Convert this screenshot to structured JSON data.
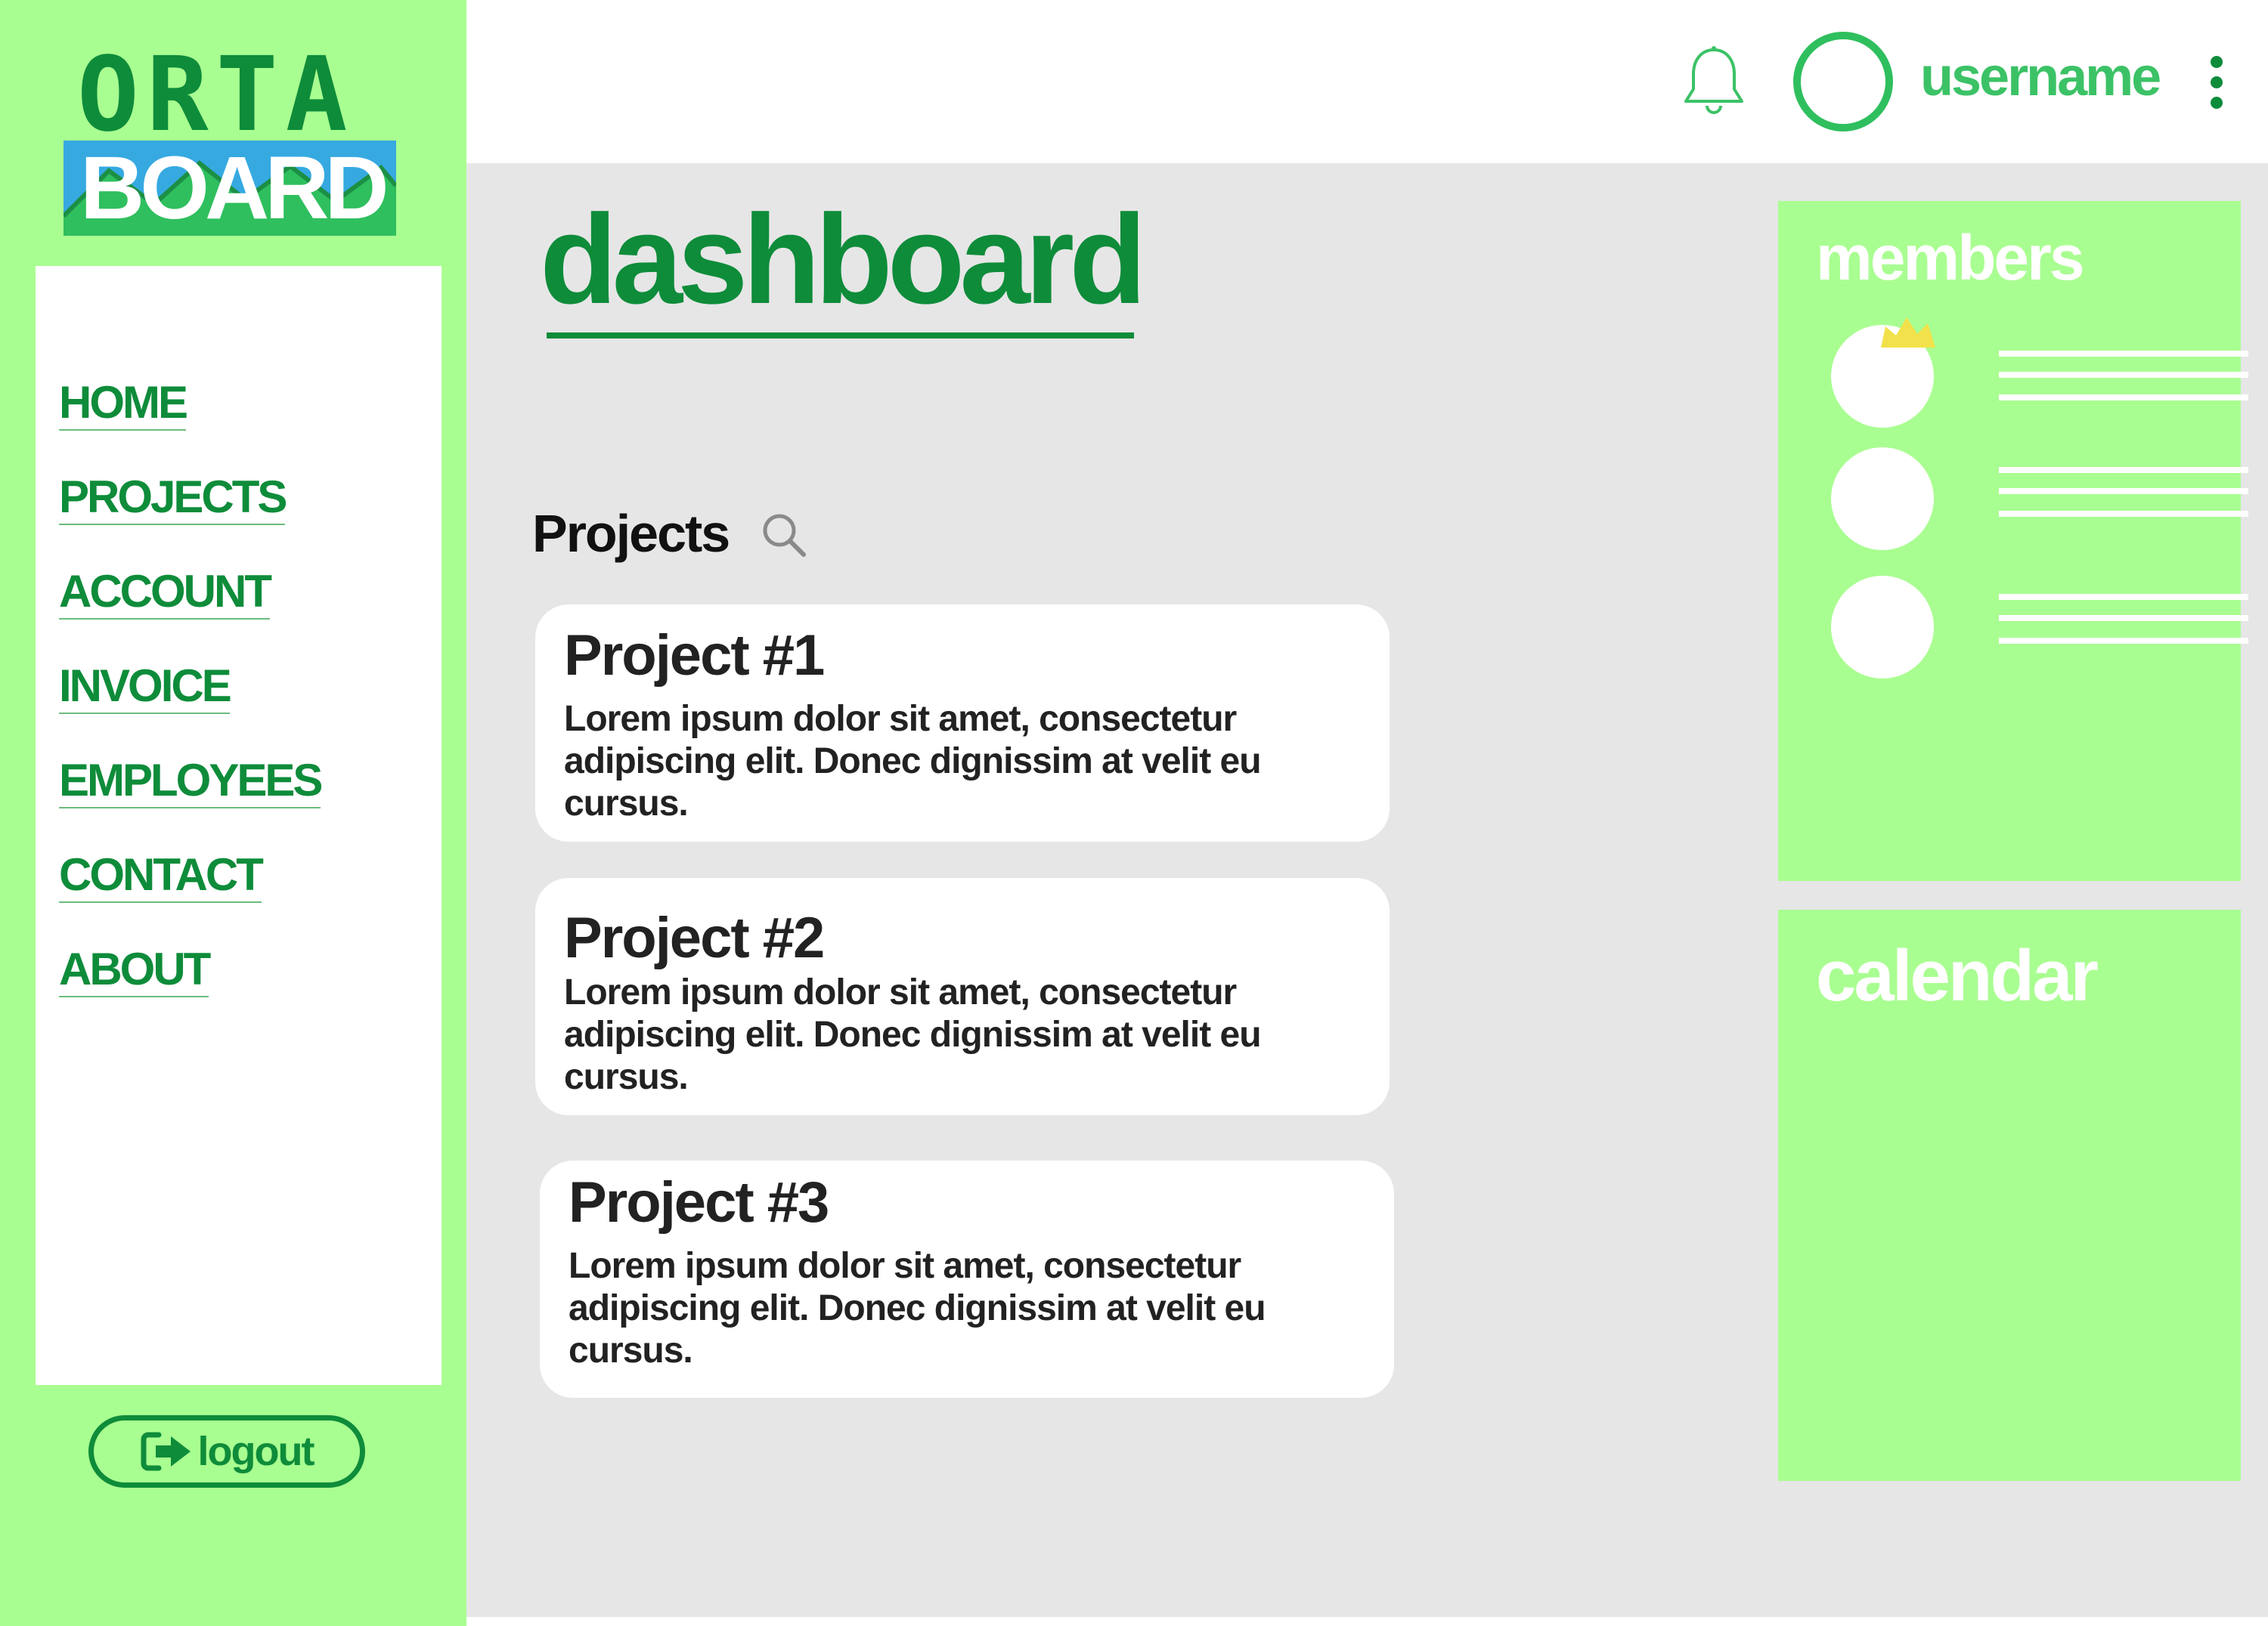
{
  "brand": {
    "line1": "ORTA",
    "line2": "BOARD",
    "colors": {
      "green": "#0e8c3a",
      "board_bg_blue": "#36a9e1",
      "board_chart_green": "#2fbf5e",
      "sidebar": "#a9fe91"
    }
  },
  "sidebar": {
    "items": [
      {
        "label": "HOME"
      },
      {
        "label": "PROJECTS"
      },
      {
        "label": "ACCOUNT"
      },
      {
        "label": "INVOICE"
      },
      {
        "label": "EMPLOYEES"
      },
      {
        "label": "CONTACT"
      },
      {
        "label": "ABOUT"
      }
    ],
    "logout": {
      "label": "logout",
      "icon": "logout-icon"
    }
  },
  "header": {
    "notification_icon": "bell-icon",
    "username": "username",
    "menu_icon": "kebab-menu-icon"
  },
  "main": {
    "title": "dashboard",
    "projects": {
      "heading": "Projects",
      "search_icon": "search-icon",
      "items": [
        {
          "title": "Project #1",
          "description": "Lorem ipsum dolor sit amet, consectetur adipiscing elit. Donec dignissim at velit eu cursus."
        },
        {
          "title": "Project #2",
          "description": "Lorem ipsum dolor sit amet, consectetur adipiscing elit. Donec dignissim at velit eu cursus."
        },
        {
          "title": "Project #3",
          "description": "Lorem ipsum dolor sit amet, consectetur adipiscing elit. Donec dignissim at velit eu cursus."
        }
      ]
    }
  },
  "widgets": {
    "members": {
      "title": "members",
      "owner_icon": "crown-icon"
    },
    "calendar": {
      "title": "calendar"
    }
  }
}
